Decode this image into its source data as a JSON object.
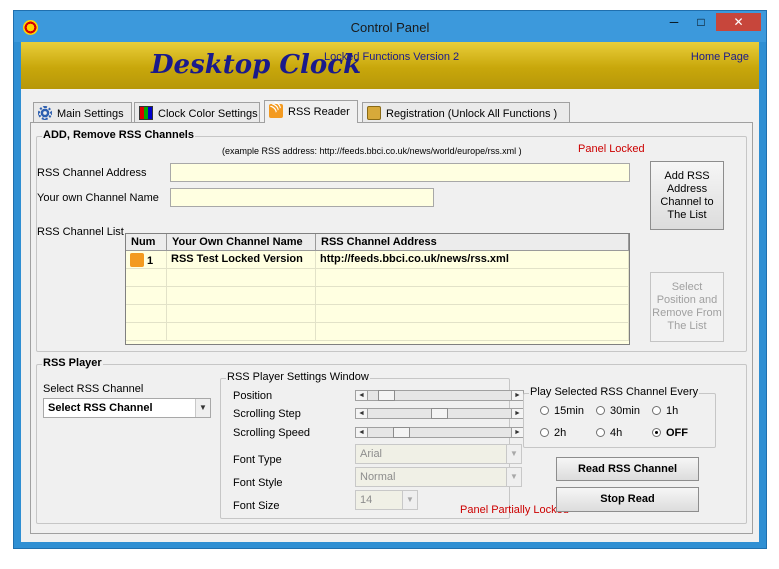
{
  "window": {
    "title": "Control Panel",
    "buttons": {
      "min": "─",
      "max": "□",
      "close": "✕"
    }
  },
  "banner": {
    "brand": "Desktop Clock",
    "version": "Locked Functions Version 2",
    "home_link": "Home Page"
  },
  "tabs": [
    {
      "label": "Main Settings",
      "icon": "gear-icon"
    },
    {
      "label": "Clock Color Settings",
      "icon": "color-palette-icon"
    },
    {
      "label": "RSS Reader",
      "icon": "rss-icon",
      "active": true
    },
    {
      "label": "Registration  (Unlock All Functions )",
      "icon": "registration-icon"
    }
  ],
  "rss_channels": {
    "title": "ADD, Remove RSS Channels",
    "example": "(example RSS address:  http://feeds.bbci.co.uk/news/world/europe/rss.xml )",
    "locked": "Panel Locked",
    "address_label": "RSS Channel Address",
    "address_value": "",
    "name_label": "Your own Channel Name",
    "name_value": "",
    "add_button": "Add RSS Address Channel to The List",
    "remove_button": "Select Position and Remove From The List",
    "list_label": "RSS Channel List",
    "columns": [
      "Num",
      "Your Own Channel Name",
      "RSS Channel Address"
    ],
    "rows": [
      {
        "num": "1",
        "name": "RSS Test Locked Version",
        "address": "http://feeds.bbci.co.uk/news/rss.xml"
      }
    ]
  },
  "player": {
    "title": "RSS Player",
    "select_label": "Select RSS Channel",
    "select_value": "Select RSS Channel",
    "settings_title": "RSS Player Settings Window",
    "position_label": "Position",
    "step_label": "Scrolling Step",
    "speed_label": "Scrolling Speed",
    "position_level": 0.08,
    "step_level": 0.5,
    "speed_level": 0.2,
    "font_type_label": "Font Type",
    "font_type_value": "Arial",
    "font_style_label": "Font Style",
    "font_style_value": "Normal",
    "font_size_label": "Font Size",
    "font_size_value": "14",
    "partial_lock": "Panel Partially Locked",
    "every_title": "Play Selected RSS Channel Every",
    "intervals": [
      "15min",
      "30min",
      "1h",
      "2h",
      "4h",
      "OFF"
    ],
    "selected_interval": "OFF",
    "read_button": "Read RSS Channel",
    "stop_button": "Stop Read"
  }
}
